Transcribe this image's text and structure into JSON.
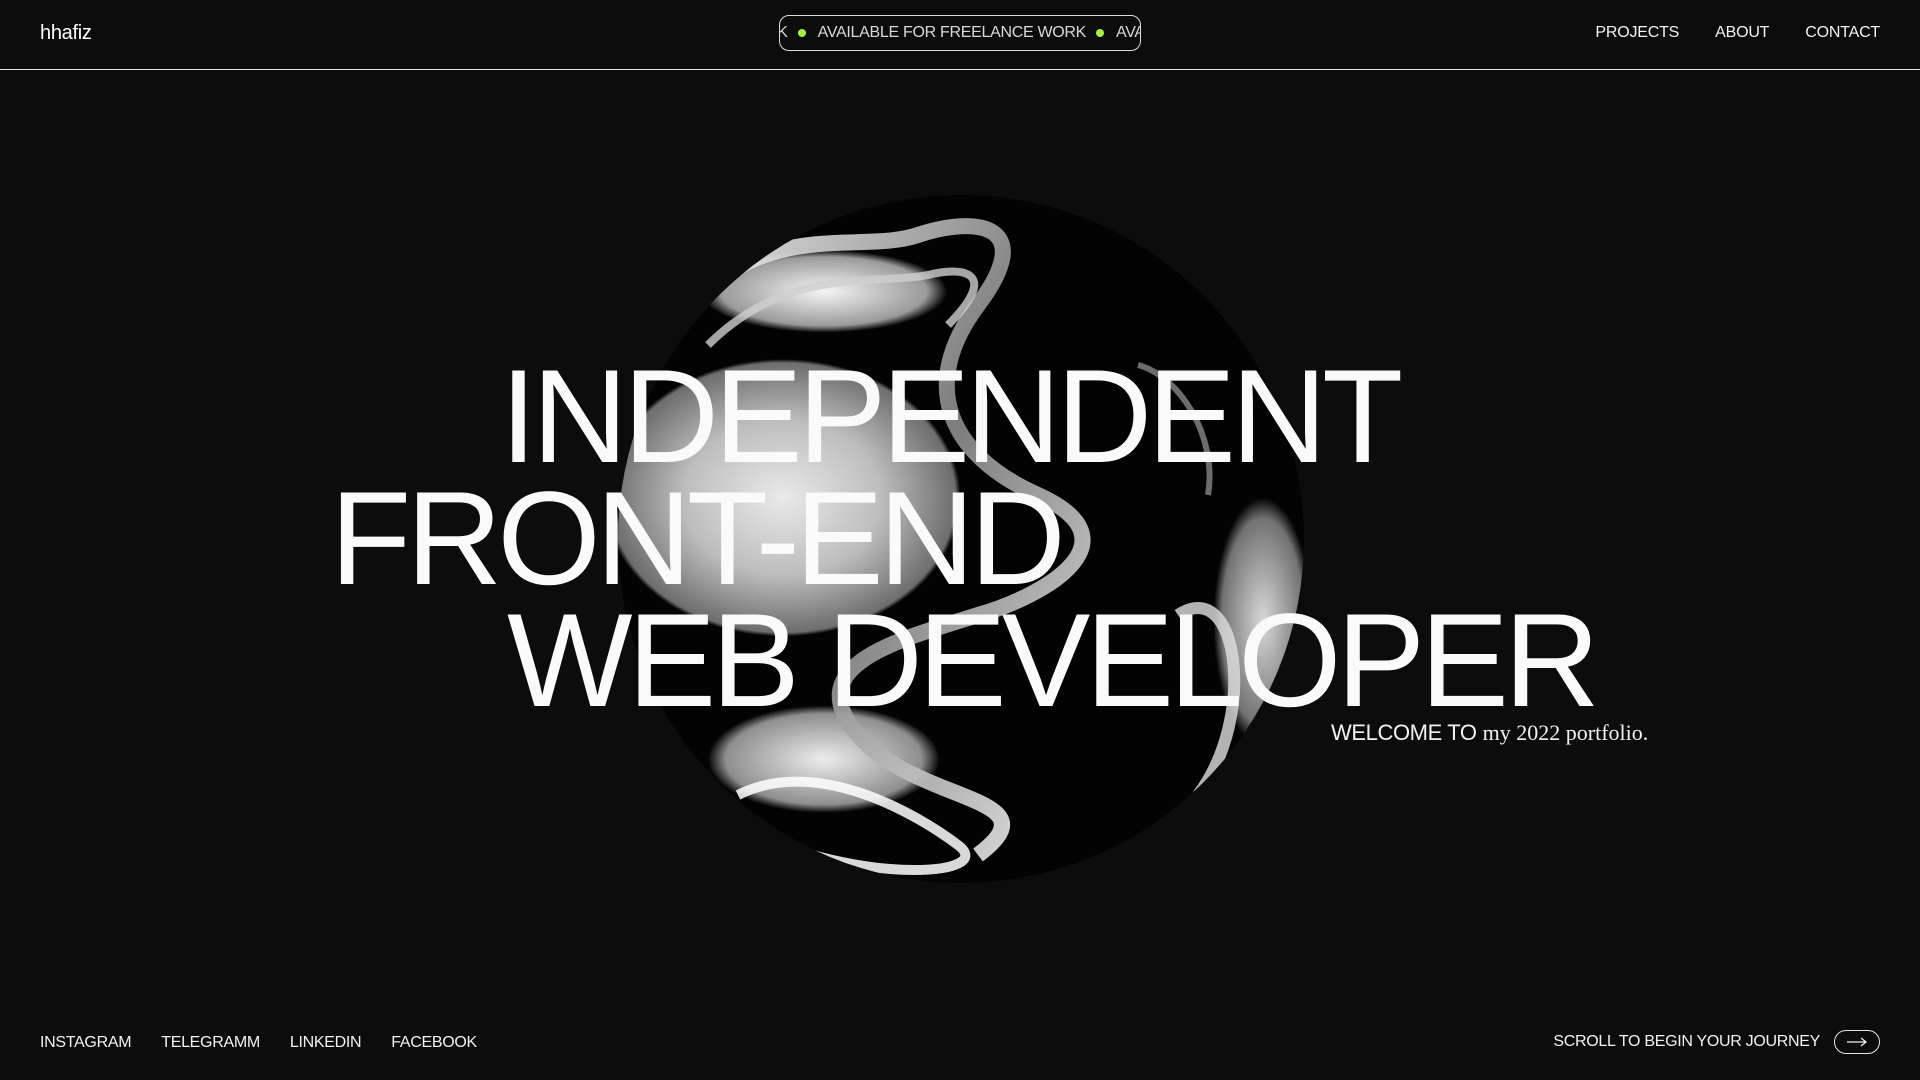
{
  "header": {
    "logo": "hhafiz",
    "ticker": {
      "items": [
        "RK",
        "AVAILABLE FOR FREELANCE WORK",
        "AVAIL"
      ],
      "dot_color": "#a6f23a"
    },
    "nav": [
      "PROJECTS",
      "ABOUT",
      "CONTACT"
    ]
  },
  "hero": {
    "lines": [
      "INDEPENDENT",
      "FRONT-END",
      "WEB DEVELOPER"
    ],
    "welcome_upper": "WELCOME TO",
    "welcome_rest": "my 2022 portfolio."
  },
  "footer": {
    "socials": [
      "INSTAGRAM",
      "TELEGRAMM",
      "LINKEDIN",
      "FACEBOOK"
    ],
    "scroll_label": "SCROLL TO BEGIN YOUR JOURNEY",
    "arrow_icon": "arrow-right-icon"
  },
  "colors": {
    "background": "#0c0c0c",
    "text": "#f2f2f2",
    "accent_dot": "#a6f23a"
  }
}
